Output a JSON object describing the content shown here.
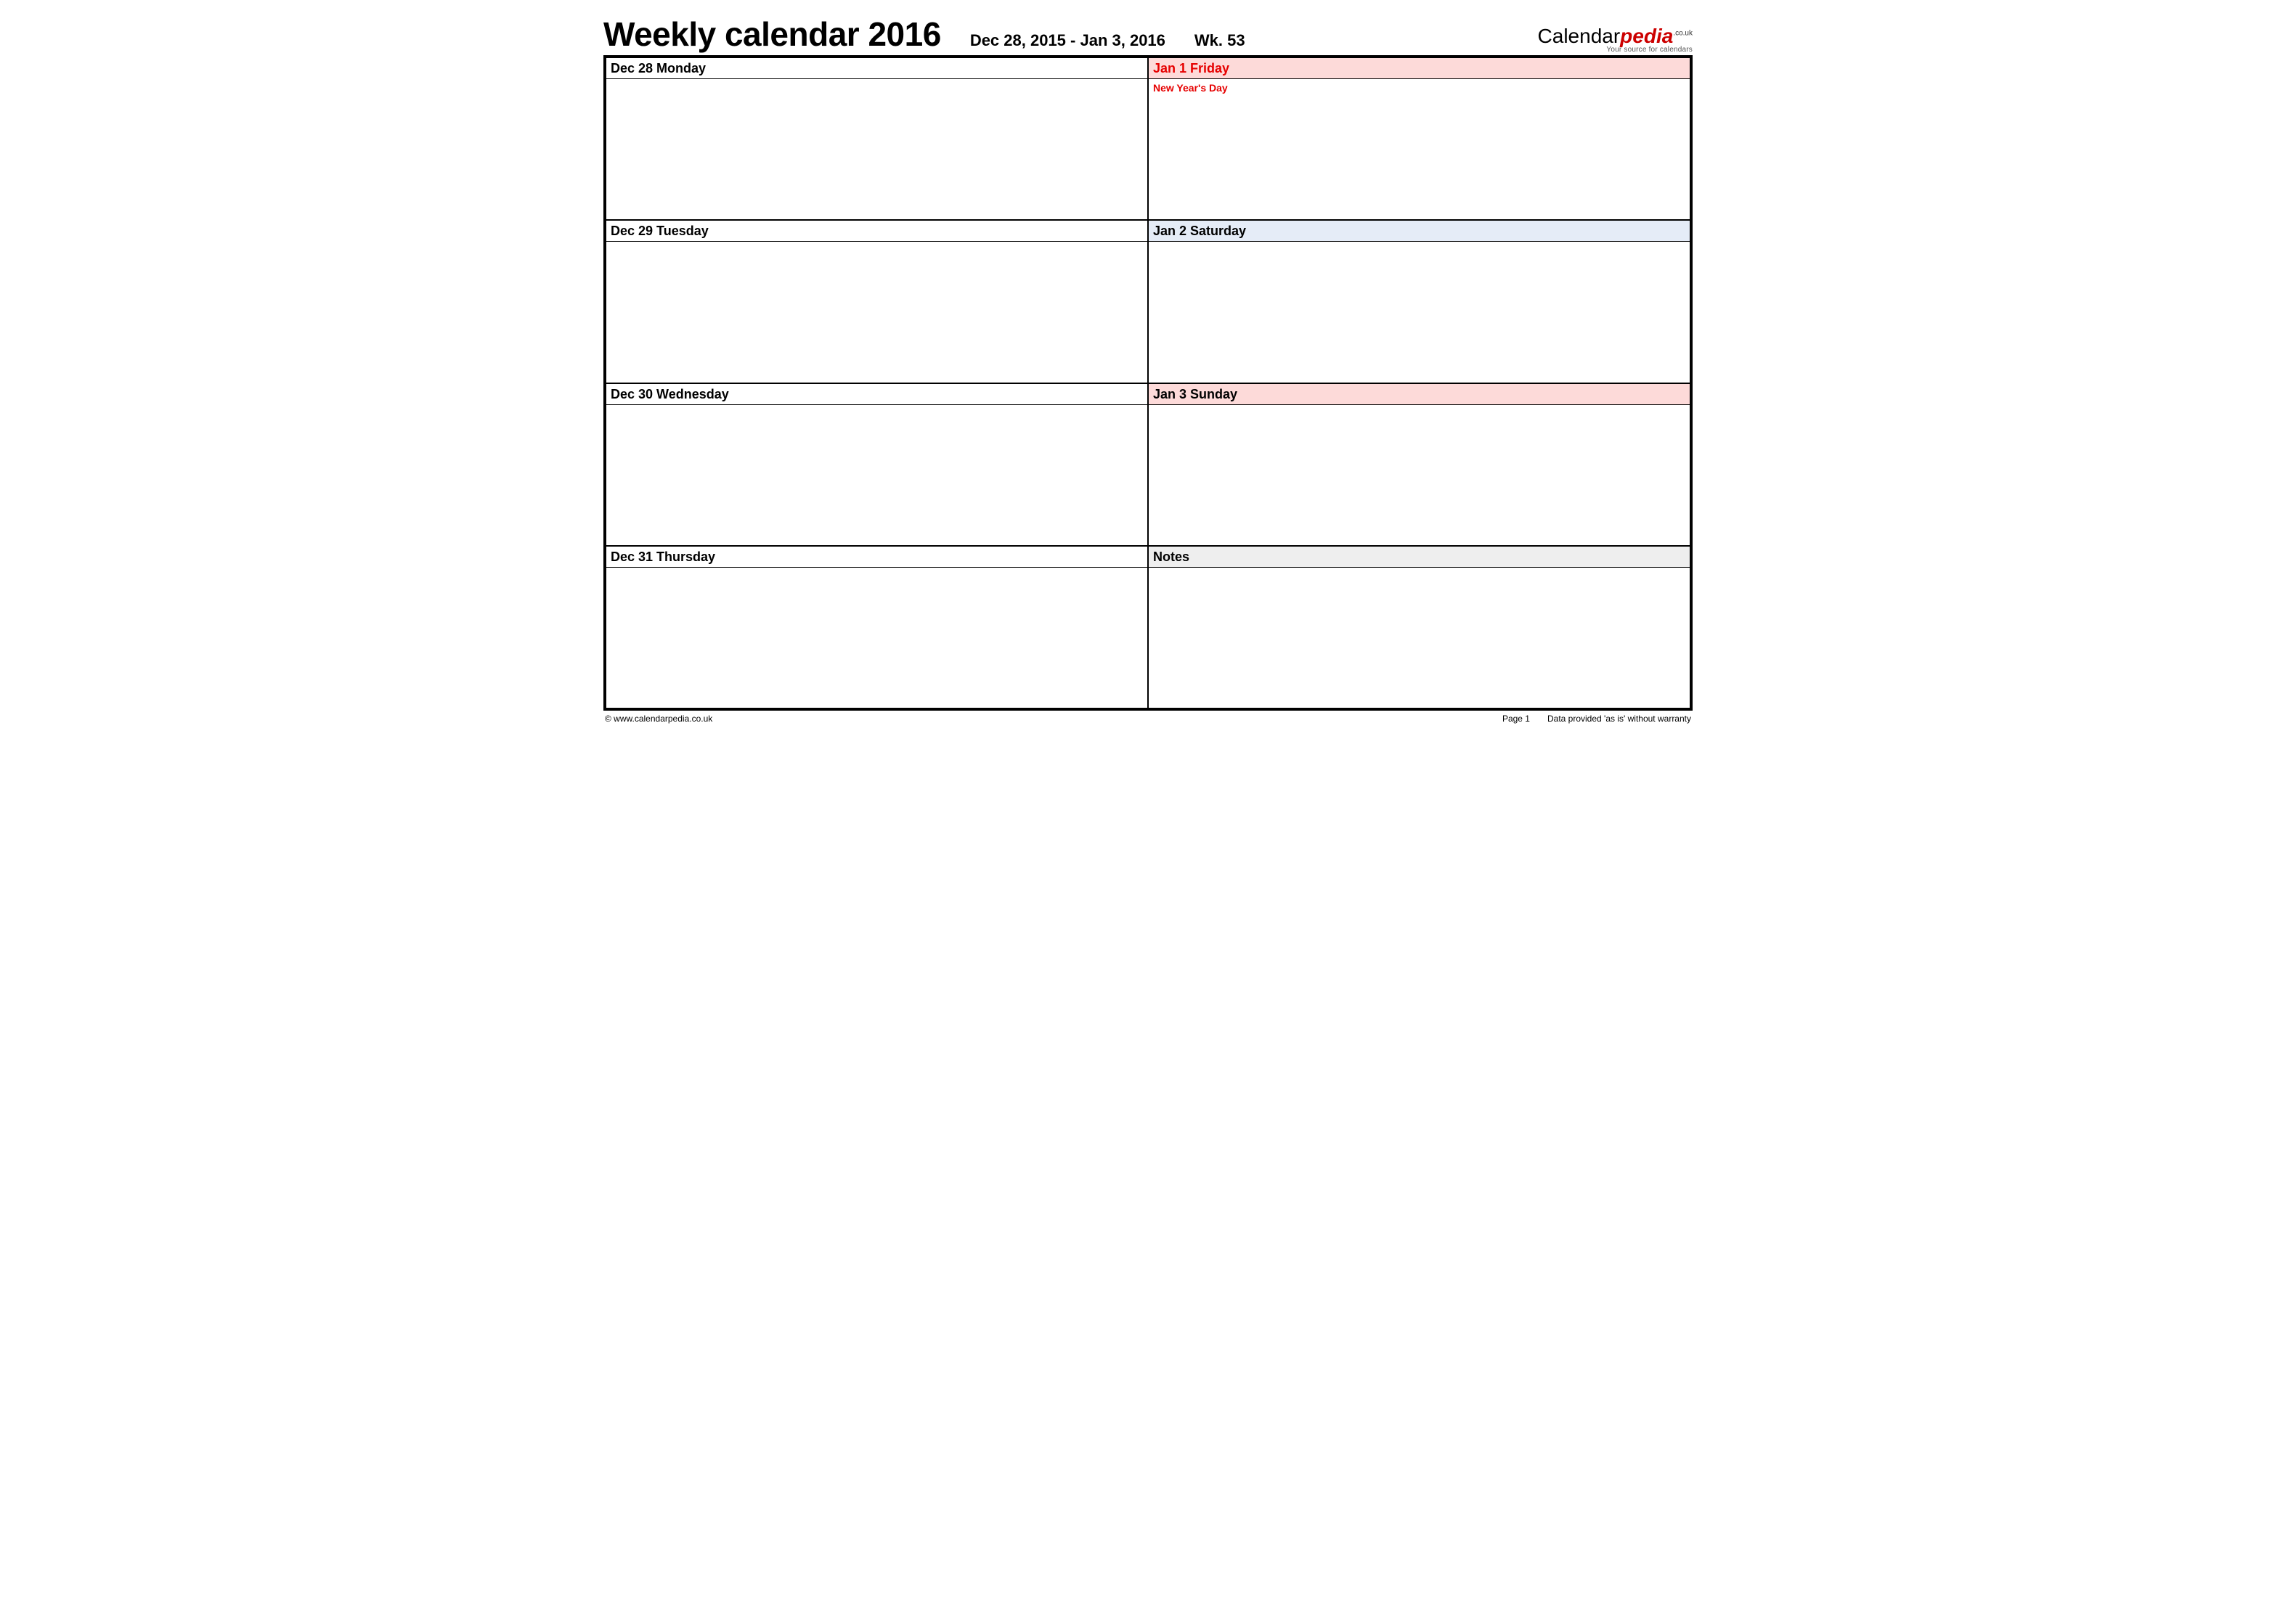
{
  "header": {
    "title": "Weekly calendar 2016",
    "range": "Dec 28, 2015 - Jan 3, 2016",
    "week": "Wk. 53"
  },
  "logo": {
    "part1": "Calendar",
    "part2": "pedia",
    "tld": ".co.uk",
    "tagline": "Your source for calendars"
  },
  "days": {
    "left": [
      {
        "label": "Dec 28  Monday",
        "note": ""
      },
      {
        "label": "Dec 29  Tuesday",
        "note": ""
      },
      {
        "label": "Dec 30  Wednesday",
        "note": ""
      },
      {
        "label": "Dec 31  Thursday",
        "note": ""
      }
    ],
    "right": [
      {
        "label": "Jan 1  Friday",
        "note": "New Year's Day"
      },
      {
        "label": "Jan 2  Saturday",
        "note": ""
      },
      {
        "label": "Jan 3  Sunday",
        "note": ""
      },
      {
        "label": "Notes",
        "note": ""
      }
    ]
  },
  "footer": {
    "copyright": "© www.calendarpedia.co.uk",
    "page": "Page 1",
    "disclaimer": "Data provided 'as is' without warranty"
  }
}
